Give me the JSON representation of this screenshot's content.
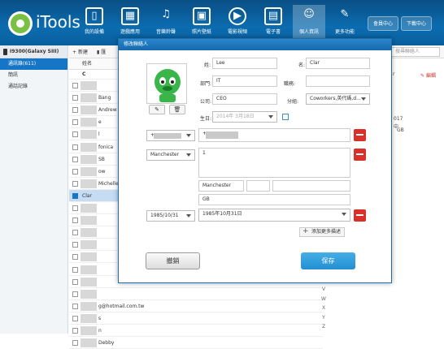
{
  "app": {
    "brand": "iTools"
  },
  "nav": [
    {
      "label": "我的設備",
      "glyph": "▯"
    },
    {
      "label": "遊戲應用",
      "glyph": "▦"
    },
    {
      "label": "音樂鈴聲",
      "glyph": "♫"
    },
    {
      "label": "照片壁紙",
      "glyph": "▣"
    },
    {
      "label": "電影視頻",
      "glyph": "▶"
    },
    {
      "label": "電子書",
      "glyph": "▤"
    },
    {
      "label": "個人資訊",
      "glyph": "☺"
    },
    {
      "label": "更多功能",
      "glyph": "✎"
    }
  ],
  "topbuttons": {
    "member": "會員中心",
    "download": "下載中心"
  },
  "sidebar": {
    "device": "I9300(Galaxy SIII)",
    "items": [
      {
        "label": "通訊錄(611)"
      },
      {
        "label": "簡訊"
      },
      {
        "label": "通話記錄"
      }
    ]
  },
  "toolbar": {
    "new_label": "新建",
    "next_label": "匯"
  },
  "list": {
    "header": "姓名",
    "section_letter": "C",
    "rows": [
      {
        "name": ""
      },
      {
        "name": "Bang"
      },
      {
        "name": "Andrew"
      },
      {
        "name": "e"
      },
      {
        "name": "l"
      },
      {
        "name": "fonica"
      },
      {
        "name": "SB"
      },
      {
        "name": "ow"
      },
      {
        "name": "Michelle"
      },
      {
        "name": "Clar",
        "selected": true
      },
      {
        "name": ""
      },
      {
        "name": ""
      },
      {
        "name": ""
      },
      {
        "name": ""
      },
      {
        "name": ""
      },
      {
        "name": ""
      },
      {
        "name": ""
      },
      {
        "name": ""
      },
      {
        "name": "g@hotmail.com.tw"
      },
      {
        "name": "s"
      },
      {
        "name": "n"
      },
      {
        "name": "Debby"
      }
    ],
    "alphabet": [
      "V",
      "W",
      "X",
      "Y",
      "Z"
    ]
  },
  "rightpanel": {
    "search_placeholder": "搜尋聯絡人",
    "edit_label": "編輯",
    "text1": "r",
    "text2": "017",
    "text3": "中",
    "text4": "GB"
  },
  "modal": {
    "title": "修改聯絡人",
    "labels": {
      "last": "姓:",
      "first": "名:",
      "dept": "部門:",
      "job": "職務:",
      "company": "公司:",
      "group": "分組:",
      "birthday": "生日:"
    },
    "values": {
      "last": "Lee",
      "first": "Clar",
      "dept": "IT",
      "job": "",
      "company": "CEO",
      "group": "Coworkers,英代碼,d...",
      "birthday_placeholder": "2014年 3月18日"
    },
    "phone_prefix": "+",
    "phone_value": "+",
    "address_type": "Manchester",
    "address_line": "1",
    "address_city": "Manchester",
    "address_country": "GB",
    "date_type": "1985/10/31",
    "date_value": "1985年10月31日",
    "add_more": "添加更多描述",
    "cancel": "撤銷",
    "save": "保存"
  }
}
